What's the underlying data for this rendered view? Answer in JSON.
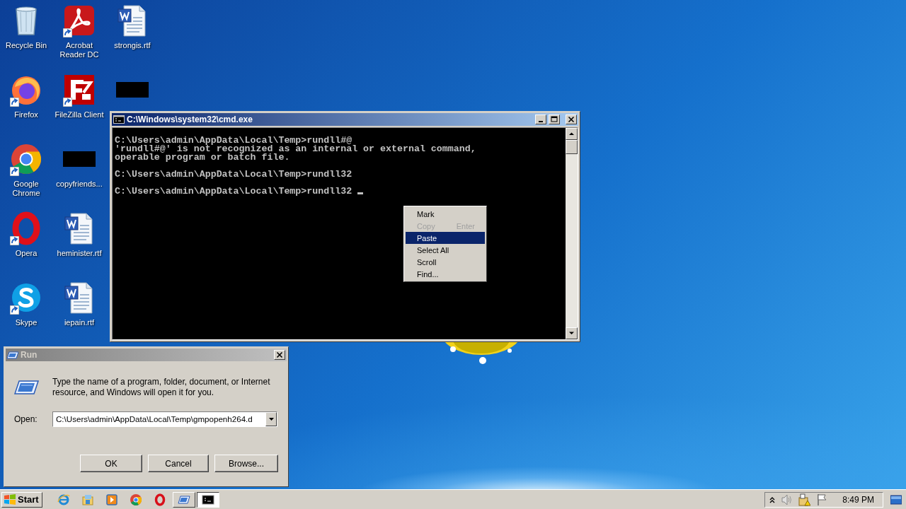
{
  "desktop_icons": [
    {
      "label": "Recycle Bin",
      "kind": "recycle-bin",
      "shortcut": false
    },
    {
      "label": "Firefox",
      "kind": "firefox",
      "shortcut": true
    },
    {
      "label": "Google Chrome",
      "kind": "chrome",
      "shortcut": true
    },
    {
      "label": "Opera",
      "kind": "opera",
      "shortcut": true
    },
    {
      "label": "Skype",
      "kind": "skype",
      "shortcut": true
    },
    {
      "label": "Acrobat Reader DC",
      "kind": "pdf",
      "shortcut": true
    },
    {
      "label": "FileZilla Client",
      "kind": "filezilla",
      "shortcut": true
    },
    {
      "label": "copyfriends...",
      "kind": "redacted",
      "shortcut": false
    },
    {
      "label": "heminister.rtf",
      "kind": "word-doc",
      "shortcut": false
    },
    {
      "label": "iepain.rtf",
      "kind": "word-doc",
      "shortcut": false
    },
    {
      "label": "strongis.rtf",
      "kind": "word-doc",
      "shortcut": false
    },
    {
      "kind": "redacted",
      "shortcut": false
    }
  ],
  "cmd_window": {
    "title": "C:\\Windows\\system32\\cmd.exe",
    "active": true,
    "blocks": [
      [
        "C:\\Users\\admin\\AppData\\Local\\Temp>rundll#@",
        "'rundll#@' is not recognized as an internal or external command,",
        "operable program or batch file."
      ],
      [
        "C:\\Users\\admin\\AppData\\Local\\Temp>rundll32"
      ],
      [
        "C:\\Users\\admin\\AppData\\Local\\Temp>rundll32 "
      ]
    ],
    "context_menu": [
      {
        "label": "Mark",
        "disabled": false,
        "selected": false
      },
      {
        "label": "Copy",
        "shortcut": "Enter",
        "disabled": true,
        "selected": false
      },
      {
        "label": "Paste",
        "disabled": false,
        "selected": true
      },
      {
        "label": "Select All",
        "disabled": false,
        "selected": false
      },
      {
        "label": "Scroll",
        "disabled": false,
        "selected": false
      },
      {
        "label": "Find...",
        "disabled": false,
        "selected": false
      }
    ]
  },
  "run_dialog": {
    "title": "Run",
    "active": false,
    "prompt": "Type the name of a program, folder, document, or Internet resource, and Windows will open it for you.",
    "open_label": "Open:",
    "value": "C:\\Users\\admin\\AppData\\Local\\Temp\\gmpopenh264.d",
    "buttons": [
      "OK",
      "Cancel",
      "Browse..."
    ]
  },
  "taskbar": {
    "start_label": "Start",
    "items": [
      {
        "kind": "ie",
        "running": false,
        "active": false
      },
      {
        "kind": "explorer",
        "running": false,
        "active": false
      },
      {
        "kind": "media",
        "running": false,
        "active": false
      },
      {
        "kind": "chrome",
        "running": false,
        "active": false
      },
      {
        "kind": "opera",
        "running": false,
        "active": false
      },
      {
        "kind": "run",
        "running": true,
        "active": false
      },
      {
        "kind": "cmd",
        "running": true,
        "active": true
      }
    ],
    "clock": "8:49 PM"
  }
}
